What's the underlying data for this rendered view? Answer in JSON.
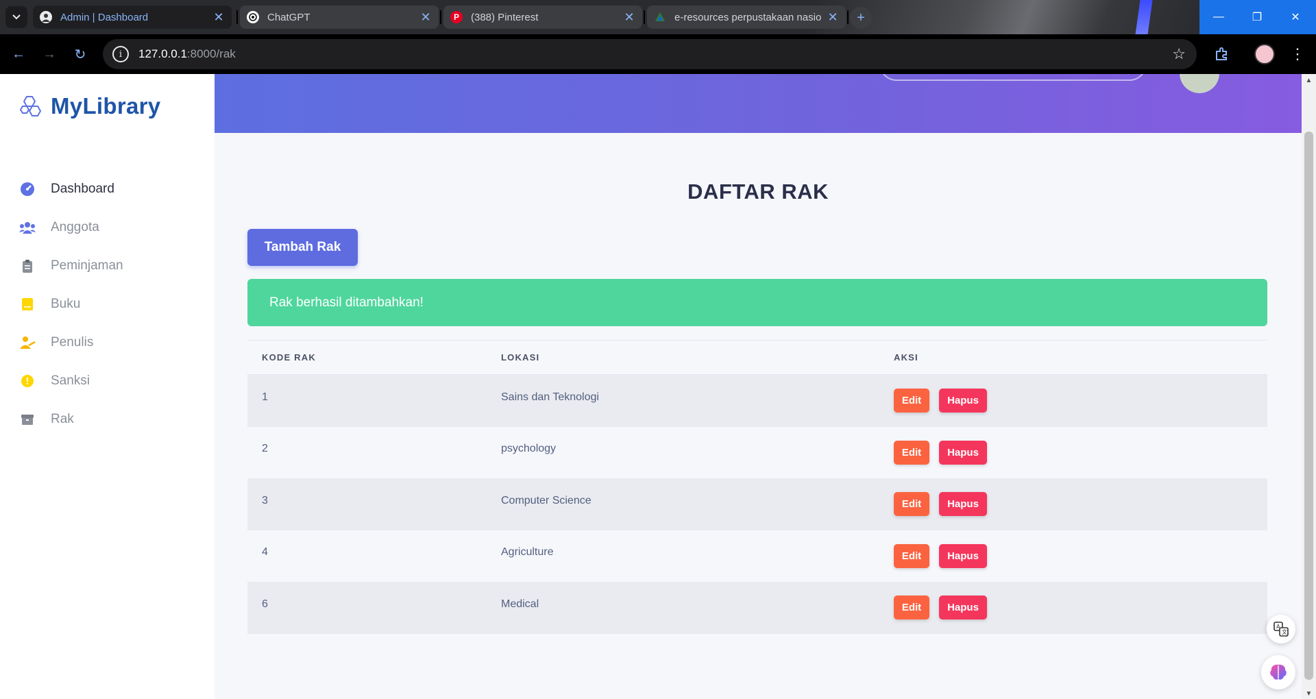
{
  "browser": {
    "tabs": [
      {
        "title": "Admin | Dashboard",
        "active": true
      },
      {
        "title": "ChatGPT",
        "active": false
      },
      {
        "title": "(388) Pinterest",
        "active": false
      },
      {
        "title": "e-resources perpustakaan nasio",
        "active": false
      }
    ],
    "url_host": "127.0.0.1",
    "url_path": ":8000/rak"
  },
  "app": {
    "brand": "MyLibrary",
    "menu": [
      {
        "label": "Dashboard",
        "icon": "gauge-icon",
        "color": "#5e72e4"
      },
      {
        "label": "Anggota",
        "icon": "users-icon",
        "color": "#5e72e4"
      },
      {
        "label": "Peminjaman",
        "icon": "clipboard-icon",
        "color": "#8a8f98"
      },
      {
        "label": "Buku",
        "icon": "book-icon",
        "color": "#ffd600"
      },
      {
        "label": "Penulis",
        "icon": "user-hand-icon",
        "color": "#f7b500"
      },
      {
        "label": "Sanksi",
        "icon": "alert-circle-icon",
        "color": "#ffd600"
      },
      {
        "label": "Rak",
        "icon": "archive-icon",
        "color": "#8a8f98"
      }
    ]
  },
  "page": {
    "title": "DAFTAR RAK",
    "add_button": "Tambah Rak",
    "alert": "Rak berhasil ditambahkan!",
    "table": {
      "headers": [
        "KODE RAK",
        "LOKASI",
        "AKSI"
      ],
      "rows": [
        {
          "kode": "1",
          "lokasi": "Sains dan Teknologi"
        },
        {
          "kode": "2",
          "lokasi": "psychology"
        },
        {
          "kode": "3",
          "lokasi": "Computer Science"
        },
        {
          "kode": "4",
          "lokasi": "Agriculture"
        },
        {
          "kode": "6",
          "lokasi": "Medical"
        }
      ],
      "edit_label": "Edit",
      "delete_label": "Hapus"
    }
  },
  "colors": {
    "primary": "#5e6ce0",
    "success": "#4fd69c",
    "edit": "#fb6340",
    "delete": "#f5365c",
    "brand": "#1e55a8"
  }
}
